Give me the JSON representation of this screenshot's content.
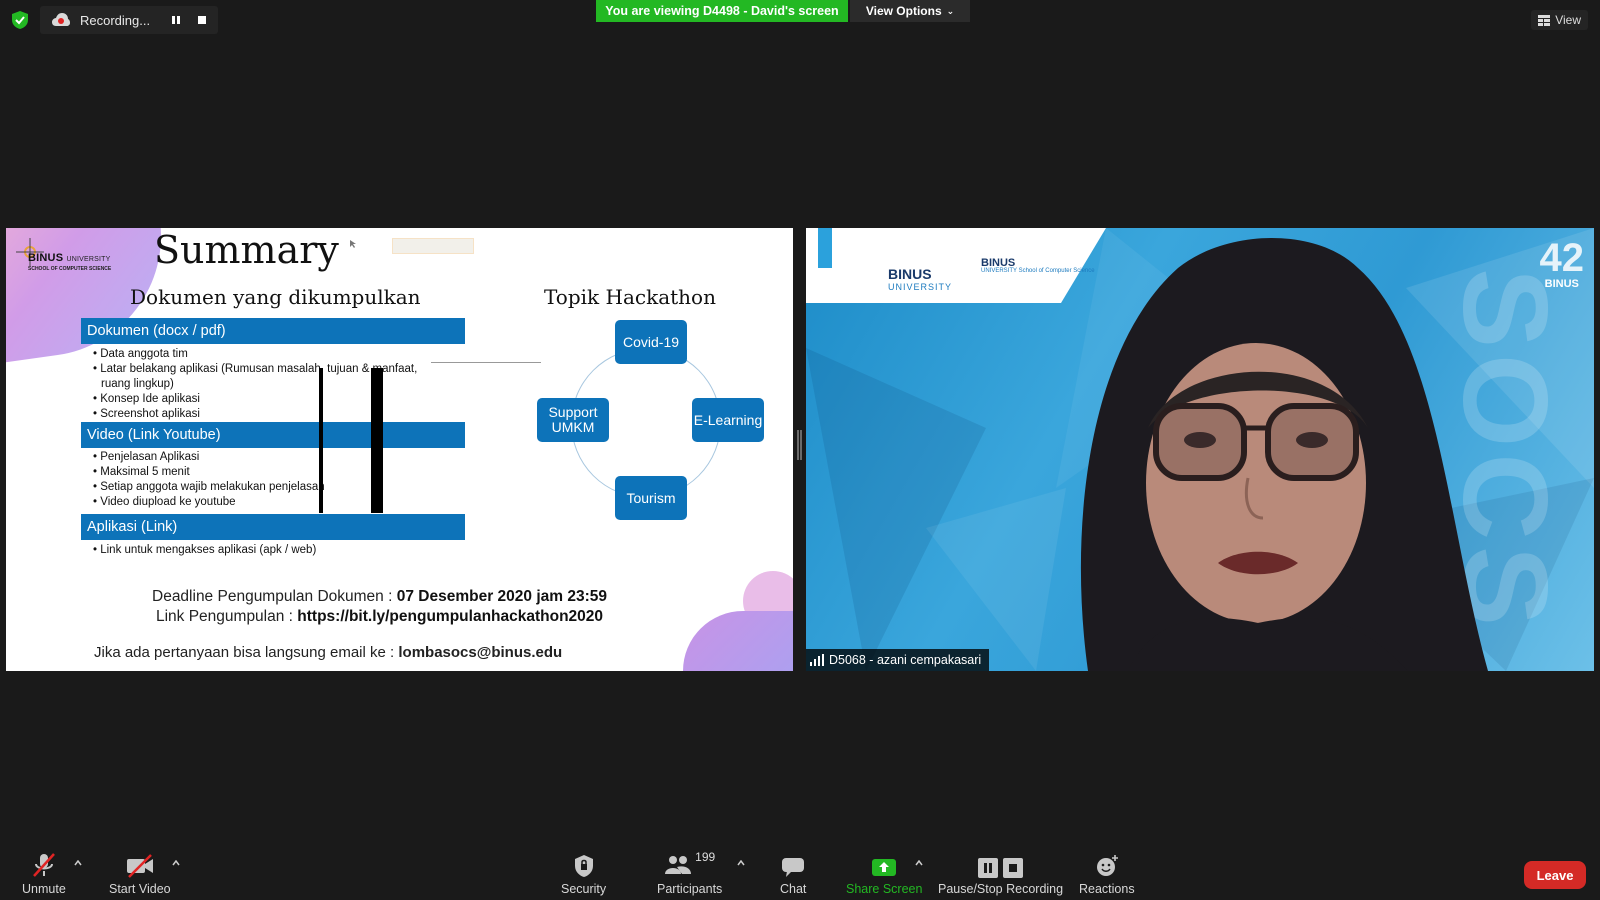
{
  "recording": {
    "label": "Recording..."
  },
  "banner": {
    "viewing": "You are viewing D4498 - David's screen",
    "view_options": "View Options"
  },
  "view_button": {
    "label": "View"
  },
  "slide": {
    "title": "Summary",
    "logo": {
      "brand": "BINUS",
      "university": "UNIVERSITY",
      "school": "SCHOOL OF COMPUTER SCIENCE"
    },
    "docs_heading": "Dokumen yang dikumpulkan",
    "topik_heading": "Topik Hackathon",
    "sections": [
      {
        "title": "Dokumen (docx / pdf)",
        "items": [
          "Data anggota tim",
          "Latar belakang aplikasi (Rumusan masalah, tujuan & manfaat, ruang lingkup)",
          "Konsep Ide aplikasi",
          "Screenshot aplikasi"
        ]
      },
      {
        "title": "Video (Link Youtube)",
        "items": [
          "Penjelasan Aplikasi",
          "Maksimal 5 menit",
          "Setiap anggota wajib melakukan penjelasan",
          "Video diupload ke youtube"
        ]
      },
      {
        "title": "Aplikasi (Link)",
        "items": [
          "Link untuk mengakses aplikasi (apk / web)"
        ]
      }
    ],
    "topics": {
      "top": "Covid-19",
      "right": "E-Learning",
      "bottom": "Tourism",
      "left": "Support UMKM"
    },
    "deadline_label": "Deadline Pengumpulan Dokumen : ",
    "deadline_value": "07 Desember 2020 jam 23:59",
    "link_label": "Link Pengumpulan : ",
    "link_value": "https://bit.ly/pengumpulanhackathon2020",
    "email_label": "Jika ada pertanyaan bisa langsung email ke : ",
    "email_value": "lombasocs@binus.edu"
  },
  "video": {
    "participant_name": "D5068 - azani cempakasari",
    "logo1_brand": "BINUS",
    "logo1_sub": "UNIVERSITY",
    "logo2_brand": "BINUS",
    "logo2_sub": "UNIVERSITY School of Computer Science",
    "corner_logo": "BINUS",
    "corner_number": "42",
    "watermark": "SOCS"
  },
  "toolbar": {
    "unmute": "Unmute",
    "start_video": "Start Video",
    "security": "Security",
    "participants": "Participants",
    "participants_count": "199",
    "chat": "Chat",
    "share_screen": "Share Screen",
    "pause_stop": "Pause/Stop Recording",
    "reactions": "Reactions",
    "leave": "Leave"
  },
  "colors": {
    "share_green": "#23b823",
    "slide_blue": "#0d73b9",
    "leave_red": "#d42a26"
  }
}
